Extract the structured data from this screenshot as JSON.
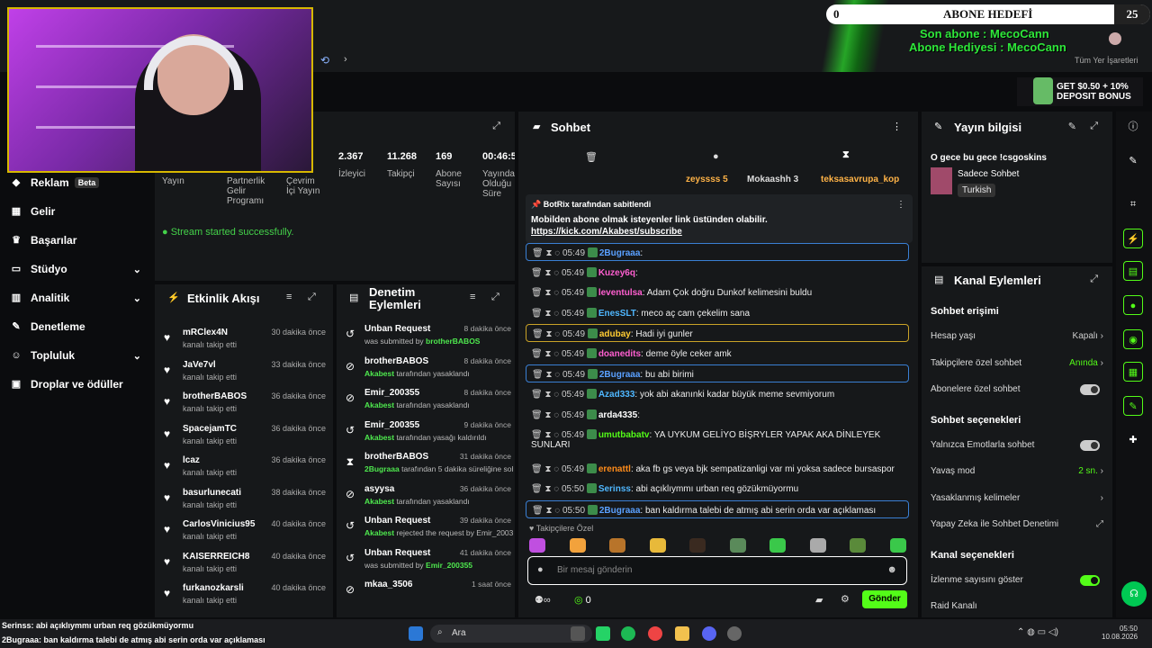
{
  "top": {
    "goal_left": "0",
    "goal_title": "ABONE HEDEFİ",
    "goal_right": "25",
    "last_sub": "Son abone : MecoCann",
    "gift_sub": "Abone Hediyesi : MecoCann",
    "bookmarks": "Tüm Yer İşaretleri",
    "ad_text_1": "GET $0.50 + 10%",
    "ad_text_2": "DEPOSIT BONUS"
  },
  "sidebar": {
    "items": [
      {
        "label": "Reklam",
        "badge": "Beta"
      },
      {
        "label": "Gelir"
      },
      {
        "label": "Başarılar"
      },
      {
        "label": "Stüdyo"
      },
      {
        "label": "Analitik"
      },
      {
        "label": "Denetleme"
      },
      {
        "label": "Topluluk"
      },
      {
        "label": "Droplar ve ödüller"
      }
    ]
  },
  "stats": {
    "labels_left": [
      "Yayın",
      "Partnerlik Gelir Programı",
      "Çevrim İçi Yayın"
    ],
    "viewers": "2.367",
    "viewers_label": "İzleyici",
    "followers": "11.268",
    "followers_label": "Takipçi",
    "subs": "169",
    "subs_label": "Abone Sayısı",
    "uptime": "00:46:5",
    "uptime_label": "Yayında Olduğu Süre",
    "success": "Stream started successfully."
  },
  "feed": {
    "title": "Etkinlik Akışı",
    "items": [
      {
        "name": "mRClex4N",
        "sub": "kanalı takip etti",
        "time": "30 dakika önce"
      },
      {
        "name": "JaVe7vl",
        "sub": "kanalı takip etti",
        "time": "33 dakika önce"
      },
      {
        "name": "brotherBABOS",
        "sub": "kanalı takip etti",
        "time": "36 dakika önce"
      },
      {
        "name": "SpacejamTC",
        "sub": "kanalı takip etti",
        "time": "36 dakika önce"
      },
      {
        "name": "lcaz",
        "sub": "kanalı takip etti",
        "time": "36 dakika önce"
      },
      {
        "name": "basurlunecati",
        "sub": "kanalı takip etti",
        "time": "38 dakika önce"
      },
      {
        "name": "CarlosVinicius95",
        "sub": "kanalı takip etti",
        "time": "40 dakika önce"
      },
      {
        "name": "KAISERREICH8",
        "sub": "kanalı takip etti",
        "time": "40 dakika önce"
      },
      {
        "name": "furkanozkarsli",
        "sub": "kanalı takip etti",
        "time": "40 dakika önce"
      }
    ]
  },
  "mod": {
    "title": "Denetim Eylemleri",
    "items": [
      {
        "name": "Unban Request",
        "s1": "was submitted by ",
        "s2": "brotherBABOS",
        "s3": "",
        "time": "8 dakika önce"
      },
      {
        "name": "brotherBABOS",
        "s1": "",
        "s2": "Akabest",
        "s3": " tarafından yasaklandı",
        "time": "8 dakika önce"
      },
      {
        "name": "Emir_200355",
        "s1": "",
        "s2": "Akabest",
        "s3": " tarafından yasaklandı",
        "time": "8 dakika önce"
      },
      {
        "name": "Emir_200355",
        "s1": "",
        "s2": "Akabest",
        "s3": " tarafından yasağı kaldırıldı",
        "time": "9 dakika önce"
      },
      {
        "name": "brotherBABOS",
        "s1": "",
        "s2": "2Bugraaa",
        "s3": " tarafından 5 dakika süreliğine sohbetten uzaklaştırıldı",
        "time": "31 dakika önce"
      },
      {
        "name": "asyysa",
        "s1": "",
        "s2": "Akabest",
        "s3": " tarafından yasaklandı",
        "time": "36 dakika önce"
      },
      {
        "name": "Unban Request",
        "s1": "",
        "s2": "Akabest",
        "s3": " rejected the request by Emir_200355",
        "time": "39 dakika önce"
      },
      {
        "name": "Unban Request",
        "s1": "was submitted by ",
        "s2": "Emir_200355",
        "s3": "",
        "time": "41 dakika önce"
      },
      {
        "name": "mkaa_3506",
        "s1": "",
        "s2": "",
        "s3": "",
        "time": "1 saat önce"
      }
    ]
  },
  "chat": {
    "title": "Sohbet",
    "leaders": [
      "zeyssss 5",
      "Mokaashh 3",
      "teksasavrupa_kop"
    ],
    "pin_by": "BotRix tarafından sabitlendi",
    "pin_text": "Mobilden abone olmak isteyenler link üstünden olabilir.",
    "pin_link": "https://kick.com/Akabest/subscribe",
    "messages": [
      {
        "time": "05:49",
        "user": "2Bugraaa",
        "color": "#5aa0ff",
        "text": ""
      },
      {
        "time": "05:49",
        "user": "Kuzey6q",
        "color": "#ff5fd0",
        "text": ""
      },
      {
        "time": "05:49",
        "user": "leventulsa",
        "color": "#ff5fd0",
        "text": "Adam Çok doğru Dunkof kelimesini buldu"
      },
      {
        "time": "05:49",
        "user": "EnesSLT",
        "color": "#4fb7ff",
        "text": "meco aç cam çekelim sana"
      },
      {
        "time": "05:49",
        "user": "adubay",
        "color": "#ffcc33",
        "text": "Hadi iyi gunler"
      },
      {
        "time": "05:49",
        "user": "doanedits",
        "color": "#ff5fd0",
        "text": "deme öyle ceker amk"
      },
      {
        "time": "05:49",
        "user": "2Bugraaa",
        "color": "#5aa0ff",
        "text": "bu abi birimi"
      },
      {
        "time": "05:49",
        "user": "Azad333",
        "color": "#4fb7ff",
        "text": "yok abi akanınki kadar büyük meme sevmiyorum"
      },
      {
        "time": "05:49",
        "user": "arda4335",
        "color": "#ffffff",
        "text": ""
      },
      {
        "time": "05:49",
        "user": "umutbabatv",
        "color": "#53fc18",
        "text": "YA UYKUM GELİYO BİŞRYLER YAPAK AKA DİNLEYEK SUNLARI"
      },
      {
        "time": "05:49",
        "user": "erenattl",
        "color": "#ff8c1a",
        "text": "aka fb gs veya bjk sempatizanligi var mi yoksa sadece bursaspor"
      },
      {
        "time": "05:50",
        "user": "Serinss",
        "color": "#4fb7ff",
        "text": "abi açıklıymmı urban req gözükmüyormu"
      },
      {
        "time": "05:50",
        "user": "2Bugraaa",
        "color": "#5aa0ff",
        "text": "ban kaldırma talebi de atmış abi serin orda var açıklaması"
      }
    ],
    "followers_only": "Takipçilere Özel",
    "placeholder": "Bir mesaj gönderin",
    "send": "Gönder",
    "points": "0"
  },
  "info": {
    "title": "Yayın bilgisi",
    "stream_title": "O gece bu gece !csgoskins",
    "category": "Sadece Sohbet",
    "tag": "Turkish"
  },
  "actions": {
    "title": "Kanal Eylemleri",
    "sec1": "Sohbet erişimi",
    "r1": "Hesap yaşı",
    "r1v": "Kapalı",
    "r2": "Takipçilere özel sohbet",
    "r2v": "Anında",
    "r3": "Abonelere özel sohbet",
    "sec2": "Sohbet seçenekleri",
    "r4": "Yalnızca Emotlarla sohbet",
    "r5": "Yavaş mod",
    "r5v": "2 sn.",
    "r6": "Yasaklanmış kelimeler",
    "r7": "Yapay Zeka ile Sohbet Denetimi",
    "sec3": "Kanal seçenekleri",
    "r8": "İzlenme sayısını göster",
    "r9": "Raid Kanalı"
  },
  "overlay": {
    "l1": "Serinss: abi açıklıymmı urban req gözükmüyormu",
    "l2": "2Bugraaa: ban kaldırma talebi de atmış abi serin orda var açıklaması"
  },
  "taskbar": {
    "search": "Ara",
    "time": "05:50",
    "date": "10.08.2026"
  }
}
